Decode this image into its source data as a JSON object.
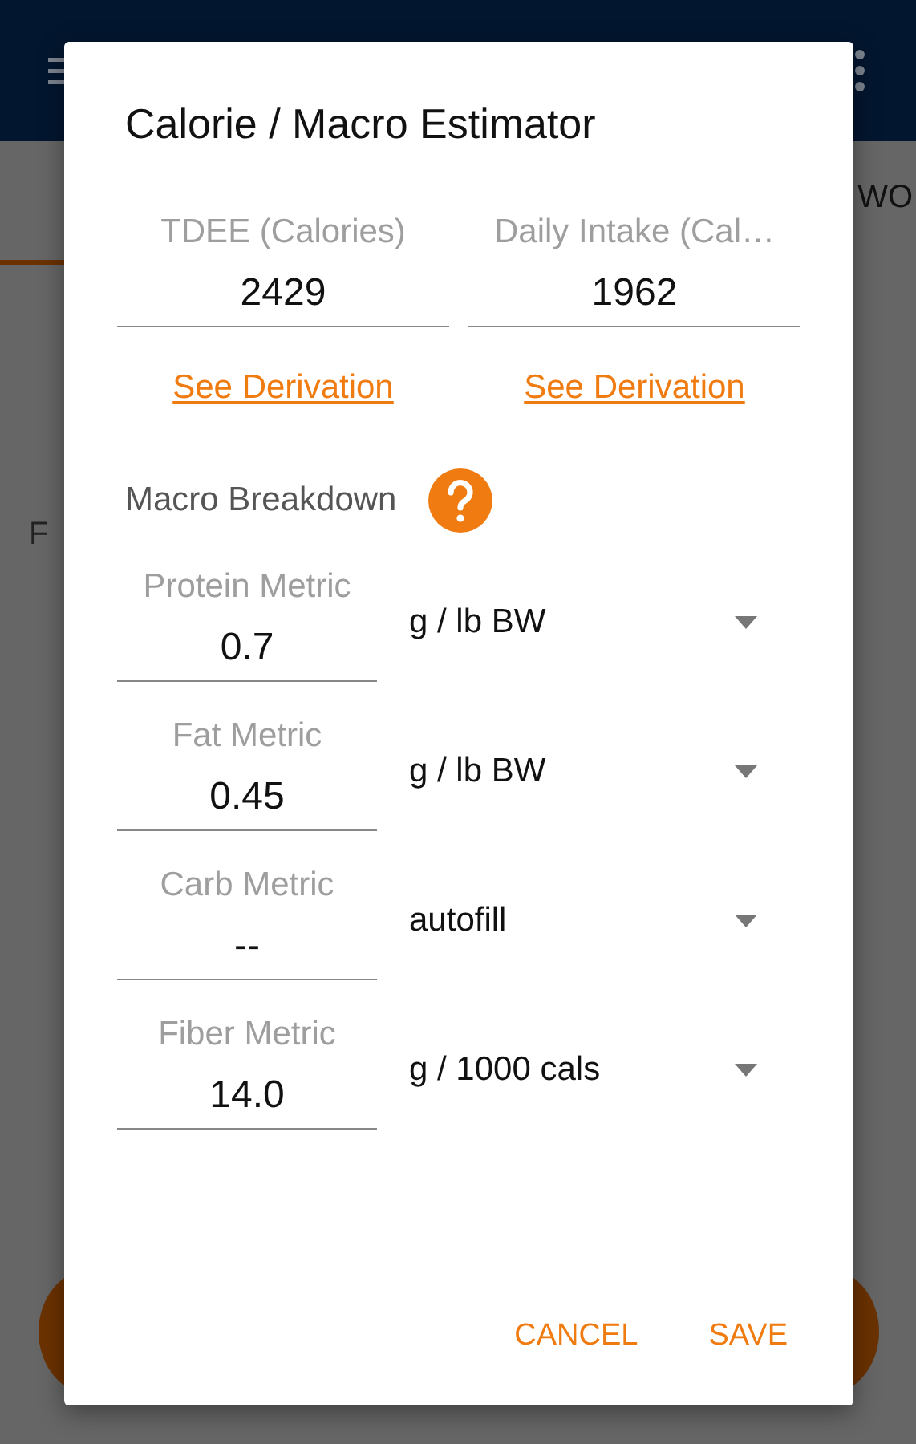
{
  "background": {
    "tab": "WO",
    "label": "F"
  },
  "dialog": {
    "title": "Calorie / Macro Estimator",
    "summary": [
      {
        "label": "TDEE (Calories)",
        "value": "2429",
        "link": "See Derivation"
      },
      {
        "label": "Daily Intake (Cal…",
        "value": "1962",
        "link": "See Derivation"
      }
    ],
    "section": "Macro Breakdown",
    "metrics": [
      {
        "label": "Protein Metric",
        "value": "0.7",
        "unit": "g / lb BW"
      },
      {
        "label": "Fat Metric",
        "value": "0.45",
        "unit": "g / lb BW"
      },
      {
        "label": "Carb Metric",
        "value": "--",
        "unit": "autofill"
      },
      {
        "label": "Fiber Metric",
        "value": "14.0",
        "unit": "g / 1000 cals"
      }
    ],
    "buttons": [
      "CANCEL",
      "SAVE"
    ]
  }
}
